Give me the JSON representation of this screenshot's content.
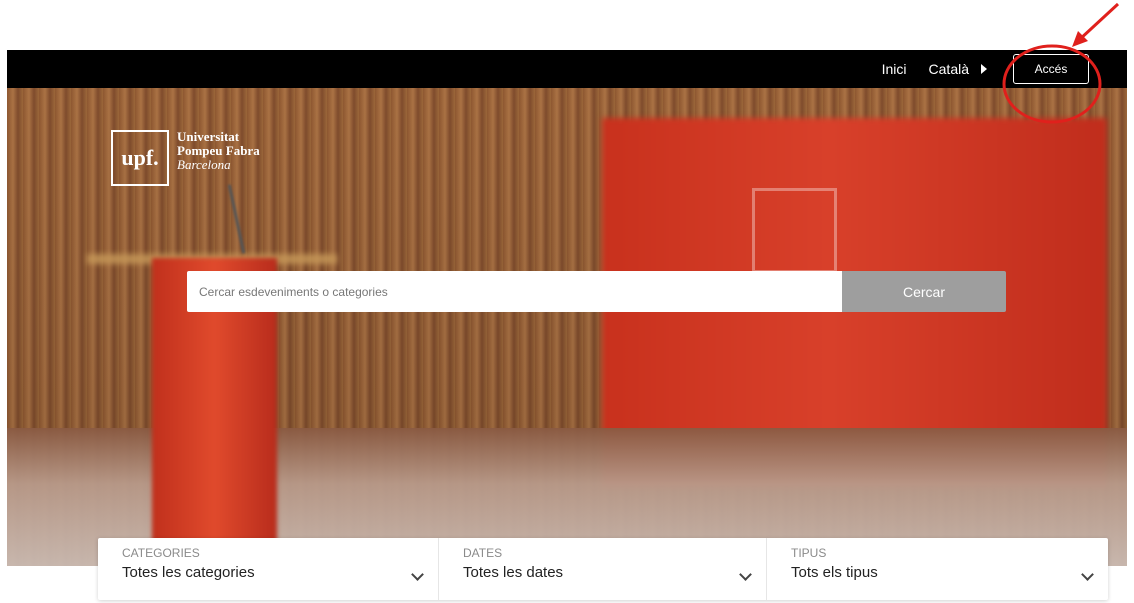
{
  "topbar": {
    "home_label": "Inici",
    "language_label": "Català",
    "access_label": "Accés"
  },
  "logo": {
    "mark": "upf.",
    "line1": "Universitat",
    "line2": "Pompeu Fabra",
    "line3": "Barcelona"
  },
  "search": {
    "placeholder": "Cercar esdeveniments o categories",
    "button_label": "Cercar"
  },
  "filters": [
    {
      "label": "CATEGORIES",
      "value": "Totes les categories"
    },
    {
      "label": "DATES",
      "value": "Totes les dates"
    },
    {
      "label": "TIPUS",
      "value": "Tots els tipus"
    }
  ],
  "colors": {
    "topbar_bg": "#000000",
    "search_button_bg": "#9e9e9e",
    "annotation_red": "#e0201c",
    "hero_red": "#d8402a"
  }
}
